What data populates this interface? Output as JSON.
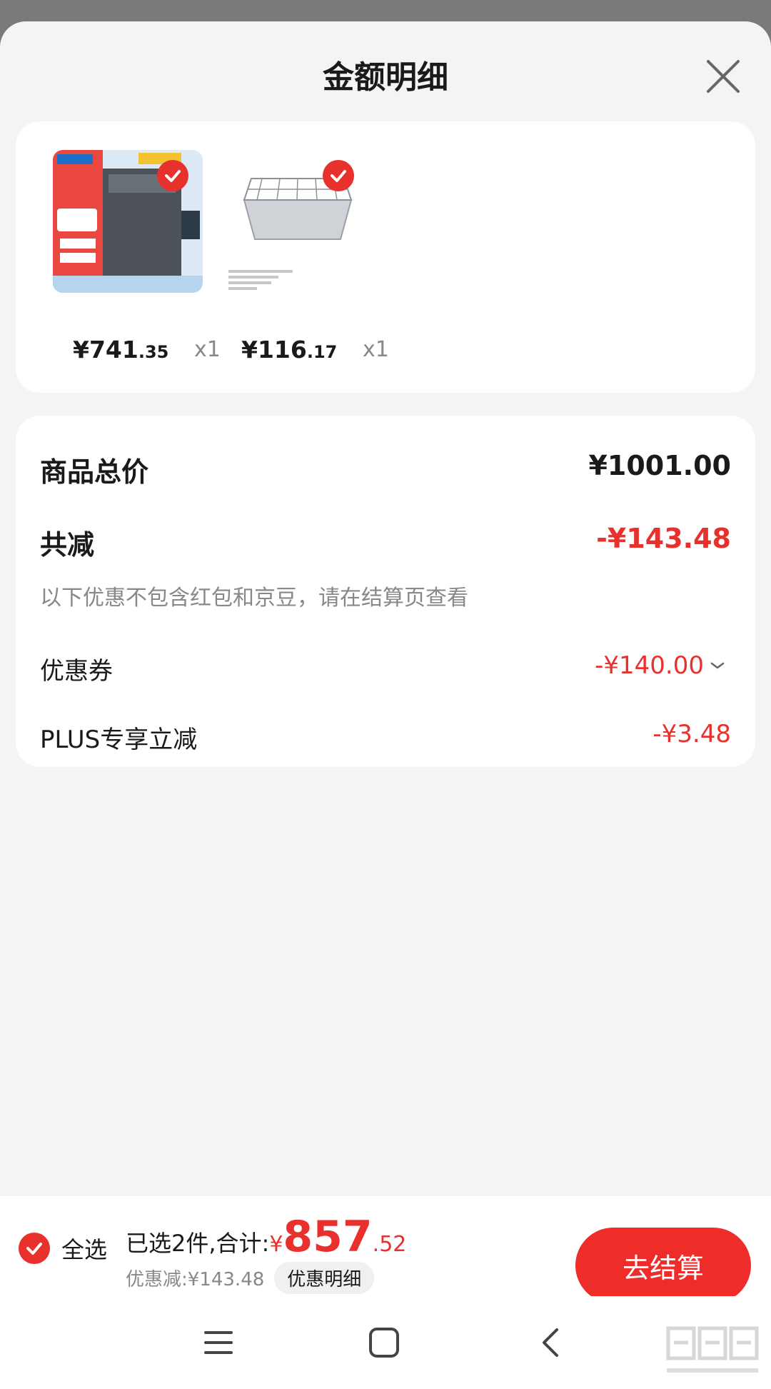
{
  "header": {
    "title": "金额明细"
  },
  "products": [
    {
      "price_int": "¥741",
      "price_dec": ".35",
      "qty": "x1",
      "image": "washing-machine-product-image",
      "checked": true
    },
    {
      "price_int": "¥116",
      "price_dec": ".17",
      "qty": "x1",
      "image": "steel-tray-product-image",
      "checked": true
    }
  ],
  "summary": {
    "total_label": "商品总价",
    "total_value": "¥1001.00",
    "reduce_label": "共减",
    "reduce_value": "-¥143.48",
    "note": "以下优惠不包含红包和京豆，请在结算页查看",
    "coupon_label": "优惠券",
    "coupon_value": "-¥140.00",
    "plus_label": "PLUS专享立减",
    "plus_value": "-¥3.48"
  },
  "footer": {
    "select_all": "全选",
    "selected_text": "已选2件,合计:",
    "currency": "¥",
    "total_int": "857",
    "total_dec": ".52",
    "discount_text": "优惠减:¥143.48",
    "detail_button": "优惠明细",
    "checkout_button": "去结算"
  },
  "navbar": {
    "icons": [
      "menu-icon",
      "home-icon",
      "back-icon"
    ]
  },
  "colors": {
    "accent": "#e8302c",
    "background": "#f4f4f4",
    "card": "#ffffff"
  }
}
